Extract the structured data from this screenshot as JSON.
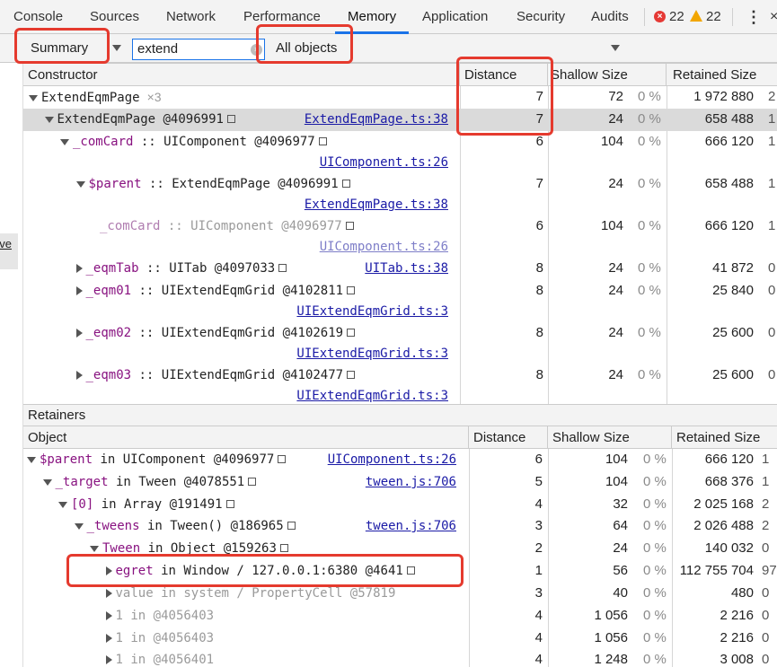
{
  "tabs": [
    {
      "label": "Console"
    },
    {
      "label": "Sources"
    },
    {
      "label": "Network"
    },
    {
      "label": "Performance"
    },
    {
      "label": "Memory"
    },
    {
      "label": "Application"
    },
    {
      "label": "Security"
    },
    {
      "label": "Audits"
    }
  ],
  "active_tab": "Memory",
  "status": {
    "errors": "22",
    "warnings": "22"
  },
  "toolbar": {
    "view_select": "Summary",
    "filter_value": "extend",
    "filter_select": "All objects"
  },
  "left_strip": {
    "save_label": "ave"
  },
  "top_grid": {
    "headers": {
      "constructor": "Constructor",
      "distance": "Distance",
      "shallow": "Shallow Size",
      "retained": "Retained Size"
    },
    "rows": [
      {
        "indent": 0,
        "toggle": "down",
        "name": "ExtendEqmPage",
        "suffix": "×3",
        "distance": "7",
        "shallow": "72",
        "shallow_pct": "0 %",
        "retained": "1 972 880",
        "edge": "2"
      },
      {
        "indent": 1,
        "toggle": "down",
        "name": "ExtendEqmPage @4096991",
        "box": true,
        "link": "ExtendEqmPage.ts:38",
        "distance": "7",
        "shallow": "24",
        "shallow_pct": "0 %",
        "retained": "658 488",
        "edge": "1",
        "selected": true
      },
      {
        "indent": 2,
        "toggle": "down",
        "prop": "_comCard",
        "name": " :: UIComponent @4096977",
        "box": true,
        "link2": "UIComponent.ts:26",
        "distance": "6",
        "shallow": "104",
        "shallow_pct": "0 %",
        "retained": "666 120",
        "edge": "1"
      },
      {
        "indent": 3,
        "toggle": "down",
        "prop": "$parent",
        "name": " :: ExtendEqmPage @4096991",
        "box": true,
        "link2": "ExtendEqmPage.ts:38",
        "distance": "7",
        "shallow": "24",
        "shallow_pct": "0 %",
        "retained": "658 488",
        "edge": "1"
      },
      {
        "indent": 4,
        "toggle": "none",
        "prop": "_comCard",
        "name": " :: UIComponent @4096977",
        "box": true,
        "link2": "UIComponent.ts:26",
        "distance": "6",
        "shallow": "104",
        "shallow_pct": "0 %",
        "retained": "666 120",
        "edge": "1",
        "dim": true
      },
      {
        "indent": 3,
        "toggle": "right",
        "prop": "_eqmTab",
        "name": " :: UITab @4097033",
        "box": true,
        "link": "UITab.ts:38",
        "distance": "8",
        "shallow": "24",
        "shallow_pct": "0 %",
        "retained": "41 872",
        "edge": "0"
      },
      {
        "indent": 3,
        "toggle": "right",
        "prop": "_eqm01",
        "name": " :: UIExtendEqmGrid @4102811",
        "box": true,
        "link2": "UIExtendEqmGrid.ts:3",
        "distance": "8",
        "shallow": "24",
        "shallow_pct": "0 %",
        "retained": "25 840",
        "edge": "0"
      },
      {
        "indent": 3,
        "toggle": "right",
        "prop": "_eqm02",
        "name": " :: UIExtendEqmGrid @4102619",
        "box": true,
        "link2": "UIExtendEqmGrid.ts:3",
        "distance": "8",
        "shallow": "24",
        "shallow_pct": "0 %",
        "retained": "25 600",
        "edge": "0"
      },
      {
        "indent": 3,
        "toggle": "right",
        "prop": "_eqm03",
        "name": " :: UIExtendEqmGrid @4102477",
        "box": true,
        "link2": "UIExtendEqmGrid.ts:3",
        "distance": "8",
        "shallow": "24",
        "shallow_pct": "0 %",
        "retained": "25 600",
        "edge": "0"
      }
    ]
  },
  "retainers": {
    "title": "Retainers",
    "headers": {
      "object": "Object",
      "distance": "Distance",
      "shallow": "Shallow Size",
      "retained": "Retained Size"
    },
    "rows": [
      {
        "indent": 0,
        "toggle": "down",
        "prop": "$parent",
        "name": " in UIComponent @4096977",
        "box": true,
        "link": "UIComponent.ts:26",
        "distance": "6",
        "shallow": "104",
        "shallow_pct": "0 %",
        "retained": "666 120",
        "edge": "1"
      },
      {
        "indent": 1,
        "toggle": "down",
        "prop": "_target",
        "name": " in Tween @4078551",
        "box": true,
        "link": "tween.js:706",
        "distance": "5",
        "shallow": "104",
        "shallow_pct": "0 %",
        "retained": "668 376",
        "edge": "1"
      },
      {
        "indent": 2,
        "toggle": "down",
        "prop": "[0]",
        "name": " in Array @191491",
        "box": true,
        "distance": "4",
        "shallow": "32",
        "shallow_pct": "0 %",
        "retained": "2 025 168",
        "edge": "2"
      },
      {
        "indent": 3,
        "toggle": "down",
        "prop": "_tweens",
        "name": " in Tween() @186965",
        "box": true,
        "link": "tween.js:706",
        "distance": "3",
        "shallow": "64",
        "shallow_pct": "0 %",
        "retained": "2 026 488",
        "edge": "2"
      },
      {
        "indent": 4,
        "toggle": "down",
        "prop": "Tween",
        "name": " in Object @159263",
        "box": true,
        "distance": "2",
        "shallow": "24",
        "shallow_pct": "0 %",
        "retained": "140 032",
        "edge": "0"
      },
      {
        "indent": 5,
        "toggle": "right",
        "prop": "egret",
        "name": " in Window / 127.0.0.1:6380 @4641",
        "box": true,
        "distance": "1",
        "shallow": "56",
        "shallow_pct": "0 %",
        "retained": "112 755 704",
        "edge": "97"
      },
      {
        "indent": 5,
        "toggle": "right",
        "plain": "value",
        "name": " in system / PropertyCell @57819",
        "distance": "3",
        "shallow": "40",
        "shallow_pct": "0 %",
        "retained": "480",
        "edge": "0"
      },
      {
        "indent": 5,
        "toggle": "right",
        "plain": "1",
        "name": " in  @4056403",
        "distance": "4",
        "shallow": "1 056",
        "shallow_pct": "0 %",
        "retained": "2 216",
        "edge": "0"
      },
      {
        "indent": 5,
        "toggle": "right",
        "plain": "1",
        "name": " in  @4056403",
        "distance": "4",
        "shallow": "1 056",
        "shallow_pct": "0 %",
        "retained": "2 216",
        "edge": "0"
      },
      {
        "indent": 5,
        "toggle": "right",
        "plain": "1",
        "name": " in  @4056401",
        "distance": "4",
        "shallow": "1 248",
        "shallow_pct": "0 %",
        "retained": "3 008",
        "edge": "0"
      }
    ]
  },
  "colors": {
    "annotation": "#e53a2e",
    "accent": "#1a73e8",
    "error": "#e53935",
    "warning": "#f2a600"
  }
}
